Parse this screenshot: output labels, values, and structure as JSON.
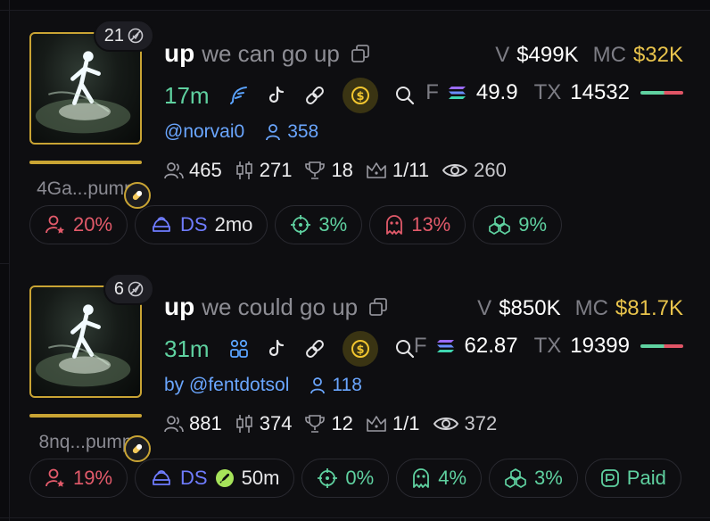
{
  "colors": {
    "gold": "#c9a434",
    "green": "#5fd1a0",
    "red": "#e25a6a",
    "blue": "#6aa6ff",
    "mc_yellow": "#e9c44c"
  },
  "tokens": [
    {
      "holders_badge": "21",
      "address": "4Ga...pump",
      "progress": 1.0,
      "ticker": "up",
      "name": "we can go up",
      "v_label": "V",
      "volume": "$499K",
      "mc_label": "MC",
      "market_cap": "$32K",
      "age": "17m",
      "link_icon_1": "feather-icon",
      "f_label": "F",
      "f_value": "49.9",
      "tx_label": "TX",
      "tx_count": "14532",
      "creator": "@norvai0",
      "creator_followers": "358",
      "holders": "465",
      "snipers": "271",
      "top_holders": "18",
      "rank": "1/11",
      "views": "260",
      "chips": [
        {
          "icon": "user-star-icon",
          "color": "red",
          "value": "20%"
        },
        {
          "icon": "dev-hat-icon",
          "color": "blue",
          "label": "DS",
          "value": "2mo"
        },
        {
          "icon": "crosshair-icon",
          "color": "green",
          "value": "3%"
        },
        {
          "icon": "ghost-icon",
          "color": "red",
          "value": "13%"
        },
        {
          "icon": "bundle-icon",
          "color": "green",
          "value": "9%"
        }
      ]
    },
    {
      "holders_badge": "6",
      "address": "8nq...pump",
      "progress": 1.0,
      "ticker": "up",
      "name": "we could go up",
      "v_label": "V",
      "volume": "$850K",
      "mc_label": "MC",
      "market_cap": "$81.7K",
      "age": "31m",
      "link_icon_1": "community-icon",
      "f_label": "F",
      "f_value": "62.87",
      "tx_label": "TX",
      "tx_count": "19399",
      "creator": "by @fentdotsol",
      "creator_followers": "118",
      "holders": "881",
      "snipers": "374",
      "top_holders": "12",
      "rank": "1/1",
      "views": "372",
      "chips": [
        {
          "icon": "user-star-icon",
          "color": "red",
          "value": "19%"
        },
        {
          "icon": "dev-hat-icon",
          "color": "blue",
          "label": "DS",
          "value": "50m"
        },
        {
          "icon": "crosshair-icon",
          "color": "green",
          "value": "0%"
        },
        {
          "icon": "ghost-icon",
          "color": "green",
          "value": "4%"
        },
        {
          "icon": "bundle-icon",
          "color": "green",
          "value": "3%"
        },
        {
          "icon": "paid-icon",
          "color": "green",
          "value": "Paid"
        }
      ]
    }
  ]
}
